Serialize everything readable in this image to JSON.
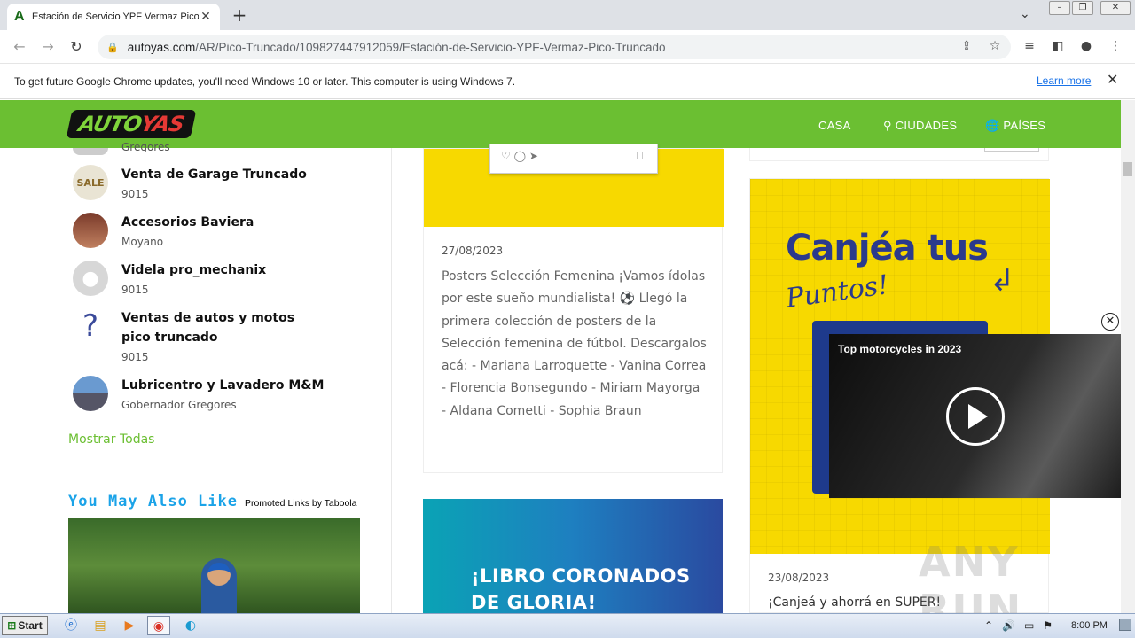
{
  "browser": {
    "tab_title": "Estación de Servicio YPF Vermaz Pico",
    "tab_favicon": "A",
    "url_host": "autoyas.com",
    "url_path": "/AR/Pico-Truncado/109827447912059/Estación-de-Servicio-YPF-Vermaz-Pico-Truncado",
    "infobar_text": "To get future Google Chrome updates, you'll need Windows 10 or later. This computer is using Windows 7.",
    "infobar_link": "Learn more"
  },
  "site": {
    "logo_a": "AUTO",
    "logo_b": "YAS",
    "nav": {
      "home": "CASA",
      "cities": "CIUDADES",
      "countries": "PAÍSES"
    }
  },
  "left": {
    "partial_sub": "Gregores",
    "businesses": [
      {
        "name": "Venta de Garage Truncado",
        "sub": "9015",
        "avatar": "sale-sign-icon"
      },
      {
        "name": "Accesorios Baviera",
        "sub": "Moyano",
        "avatar": "storefront-photo"
      },
      {
        "name": "Videla pro_mechanix",
        "sub": "9015",
        "avatar": "default-user-icon"
      },
      {
        "name": "Ventas de autos y motos pico truncado",
        "sub": "9015",
        "avatar": "question-mark-icon"
      },
      {
        "name": "Lubricentro y Lavadero M&M",
        "sub": "Gobernador Gregores",
        "avatar": "building-photo"
      }
    ],
    "show_all": "Mostrar Todas",
    "you_may_also_like": "You May Also Like",
    "promoted": "Promoted Links by Taboola"
  },
  "posts": {
    "card1": {
      "date": "27/08/2023",
      "body": "Posters Selección Femenina ¡Vamos ídolas por este sueño mundialista! ⚽ Llegó la primera colección de posters de la Selección femenina de fútbol. Descargalos acá: - Mariana Larroquette - Vanina Correa - Florencia Bonsegundo - Miriam Mayorga - Aldana Cometti - Sophia Braun"
    },
    "card2": {
      "line1": "¡LIBRO CORONADOS",
      "line2": "DE GLORIA!"
    },
    "card3": {
      "h1": "Canjéa tus",
      "h2": "Puntos!",
      "date": "23/08/2023",
      "text": "¡Canjeá y ahorrá en SUPER!"
    }
  },
  "video": {
    "title": "Top motorcycles in 2023"
  },
  "watermark": "ANY RUN",
  "taskbar": {
    "start": "Start",
    "clock": "8:00 PM"
  }
}
